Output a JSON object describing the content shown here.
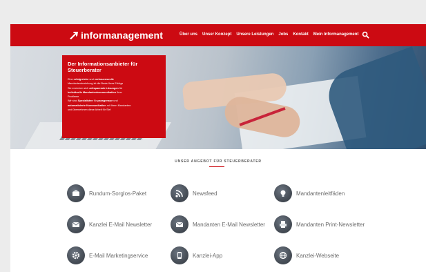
{
  "brand": {
    "name": "informanagement",
    "color": "#cc0a12"
  },
  "nav": {
    "items": [
      "Über uns",
      "Unser Konzept",
      "Unsere Leistungen",
      "Jobs",
      "Kontakt",
      "Mein Informanagement"
    ],
    "search_icon": "search-icon"
  },
  "hero": {
    "title": "Der Informationsanbieter für Steuerberater",
    "text_lines": [
      [
        "Eine ",
        "erfolgreiche",
        " und ",
        "vertrauensvolle"
      ],
      [
        "Mandantenbeziehung ist die Basis Ihres Erfolgs"
      ],
      [
        "Sie erreichen sich ",
        "zeitsparende Lösungen",
        " für"
      ],
      [
        "",
        "Individuelle Mandantenkommunikation",
        " Ihrer"
      ],
      [
        "Probleme"
      ],
      [
        "Wir sind ",
        "Spezialisten",
        " für ",
        "passgenaue",
        " und"
      ],
      [
        "",
        "automatisierte Kommunikation",
        " mit Ihren Mandanten"
      ],
      [
        "und übernehmen diese Arbeit für Sie!"
      ]
    ]
  },
  "offers": {
    "section_title": "UNSER ANGEBOT FÜR STEUERBERATER",
    "items": [
      {
        "label": "Rundum-Sorglos-Paket",
        "icon": "package-icon"
      },
      {
        "label": "Newsfeed",
        "icon": "rss-icon"
      },
      {
        "label": "Mandantenleitfäden",
        "icon": "lightbulb-icon"
      },
      {
        "label": "Kanzlei E-Mail Newsletter",
        "icon": "mail-icon"
      },
      {
        "label": "Mandanten E-Mail Newsletter",
        "icon": "mail-icon"
      },
      {
        "label": "Mandanten Print-Newsletter",
        "icon": "print-icon"
      },
      {
        "label": "E-Mail Marketingservice",
        "icon": "gear-icon"
      },
      {
        "label": "Kanzlei-App",
        "icon": "phone-icon"
      },
      {
        "label": "Kanzlei-Webseite",
        "icon": "globe-icon"
      }
    ]
  }
}
